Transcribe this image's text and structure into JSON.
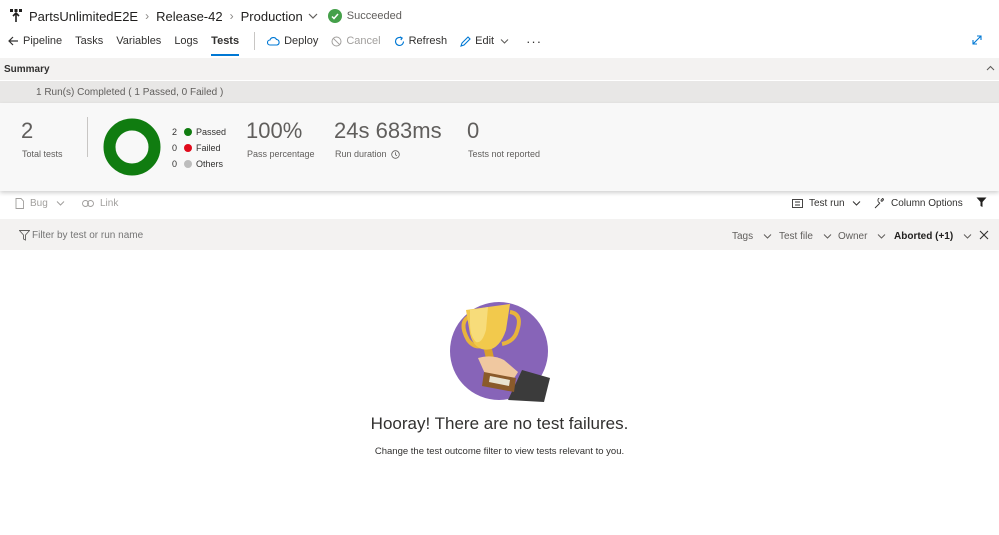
{
  "breadcrumb": {
    "project": "PartsUnlimitedE2E",
    "release": "Release-42",
    "stage": "Production",
    "status": "Succeeded"
  },
  "toolbar": {
    "pipeline": "Pipeline",
    "tasks": "Tasks",
    "variables": "Variables",
    "logs": "Logs",
    "tests": "Tests",
    "deploy": "Deploy",
    "cancel": "Cancel",
    "refresh": "Refresh",
    "edit": "Edit",
    "more": "···"
  },
  "summary": {
    "title": "Summary",
    "runs_text": "1 Run(s) Completed ( 1 Passed, 0 Failed )",
    "total_tests": "2",
    "total_tests_label": "Total tests",
    "legend": [
      {
        "count": "2",
        "label": "Passed",
        "color": "#107c10"
      },
      {
        "count": "0",
        "label": "Failed",
        "color": "#e00b1c"
      },
      {
        "count": "0",
        "label": "Others",
        "color": "#bdbdbd"
      }
    ],
    "pass_percentage": "100%",
    "pass_percentage_label": "Pass percentage",
    "run_duration": "24s 683ms",
    "run_duration_label": "Run duration",
    "tests_not_reported": "0",
    "tests_not_reported_label": "Tests not reported"
  },
  "actions": {
    "bug": "Bug",
    "link": "Link",
    "test_run": "Test run",
    "column_options": "Column Options"
  },
  "filter": {
    "placeholder": "Filter by test or run name",
    "tags": "Tags",
    "test_file": "Test file",
    "owner": "Owner",
    "outcome": "Aborted (+1)"
  },
  "empty_state": {
    "title": "Hooray! There are no test failures.",
    "subtitle": "Change the test outcome filter to view tests relevant to you."
  },
  "colors": {
    "accent": "#0078d4",
    "success": "#45a04a",
    "passed": "#107c10",
    "failed": "#e00b1c",
    "trophy_bg": "#8764b8"
  }
}
